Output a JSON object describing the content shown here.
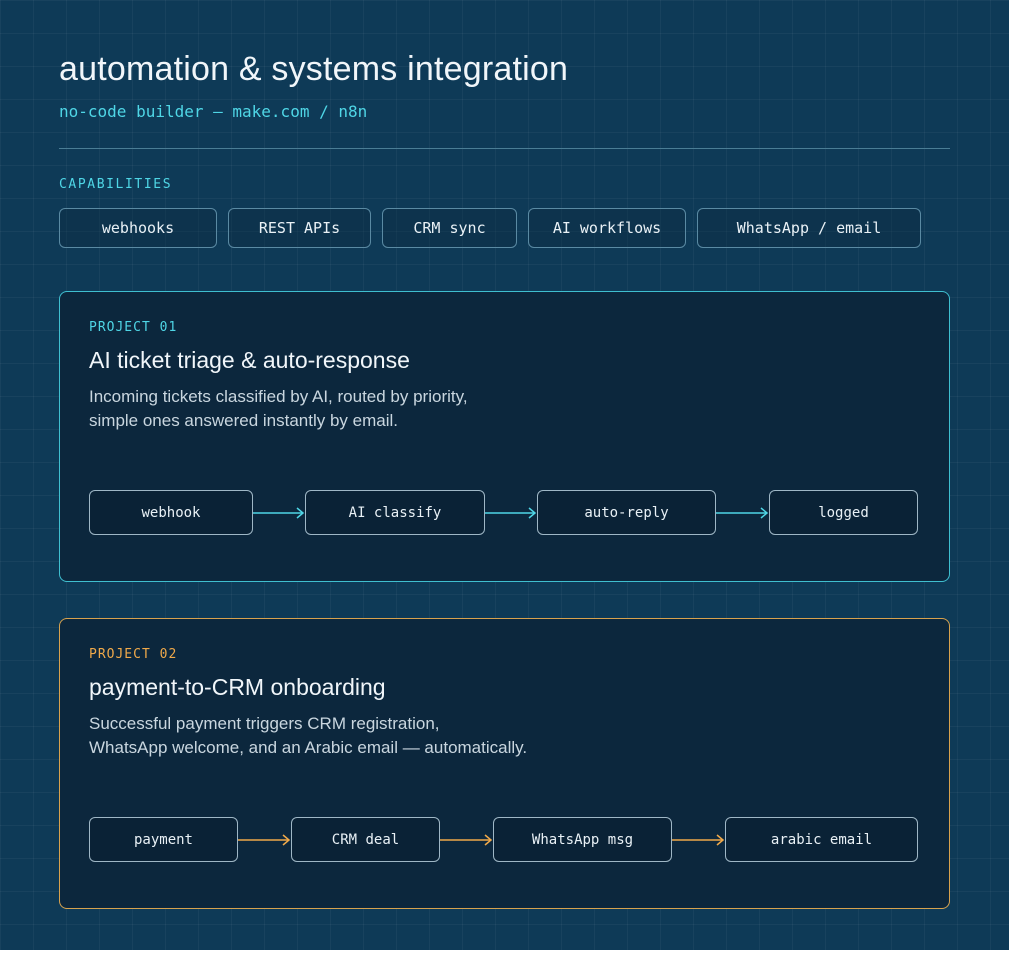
{
  "header": {
    "title": "automation & systems integration",
    "subtitle": "no-code builder — make.com / n8n"
  },
  "capabilities": {
    "heading": "CAPABILITIES",
    "chips": [
      "webhooks",
      "REST APIs",
      "CRM sync",
      "AI workflows",
      "WhatsApp / email"
    ]
  },
  "projects": [
    {
      "label": "PROJECT 01",
      "title": "AI ticket triage & auto-response",
      "description": [
        "Incoming tickets classified by AI, routed by priority,",
        "simple ones answered instantly by email."
      ],
      "accent": "#4fd6e6",
      "flow": [
        "webhook",
        "AI classify",
        "auto-reply",
        "logged"
      ]
    },
    {
      "label": "PROJECT 02",
      "title": "payment-to-CRM onboarding",
      "description": [
        "Successful payment triggers CRM registration,",
        "WhatsApp welcome, and an Arabic email — automatically."
      ],
      "accent": "#f0a94a",
      "flow": [
        "payment",
        "CRM deal",
        "WhatsApp msg",
        "arabic email"
      ]
    }
  ],
  "colors": {
    "background": "#0e3a57",
    "card": "#0c273d",
    "cyan": "#4fd6e6",
    "orange": "#f0a94a"
  }
}
